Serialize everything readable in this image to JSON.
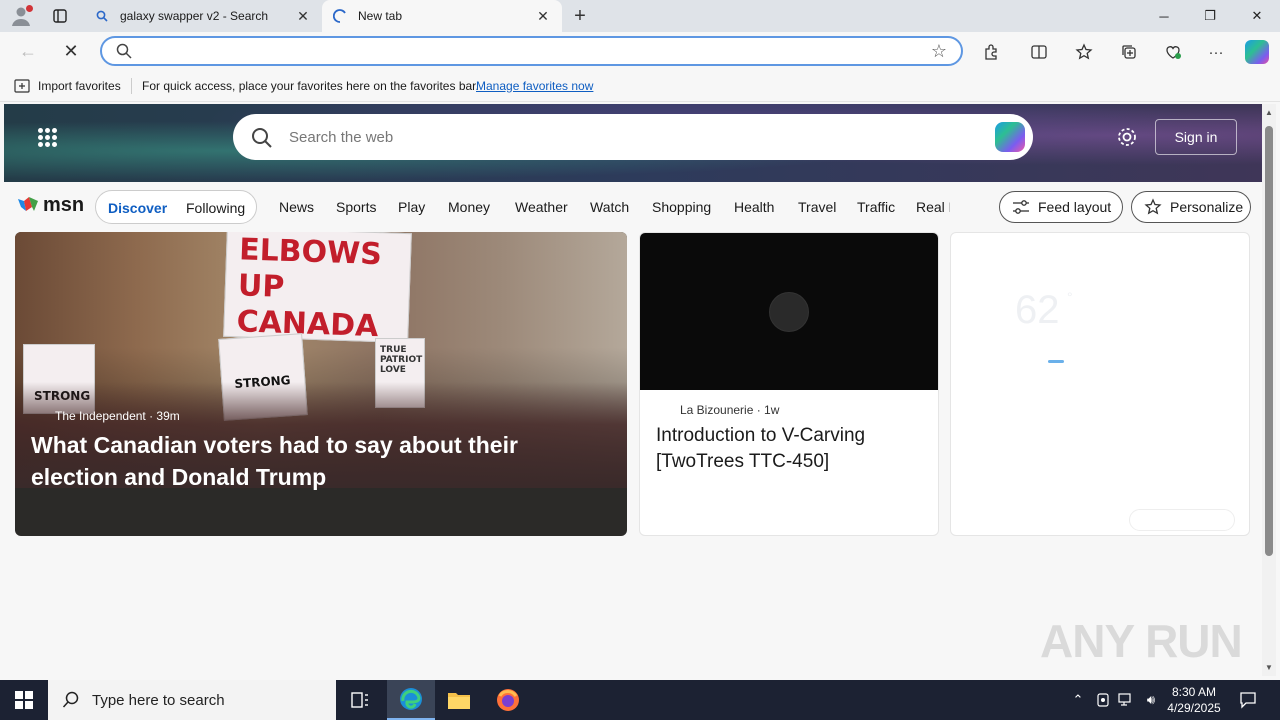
{
  "browser": {
    "tabs": [
      {
        "label": "galaxy swapper v2 - Search",
        "icon": "search-icon"
      },
      {
        "label": "New tab",
        "icon": "loading-icon"
      }
    ],
    "address": {
      "value": "",
      "placeholder": ""
    },
    "favorites_bar": {
      "import_label": "Import favorites",
      "message": "For quick access, place your favorites here on the favorites bar.",
      "link": "Manage favorites now"
    }
  },
  "msn": {
    "search_placeholder": "Search the web",
    "sign_in": "Sign in",
    "brand": "msn",
    "pivot": {
      "discover": "Discover",
      "following": "Following"
    },
    "categories": [
      "News",
      "Sports",
      "Play",
      "Money",
      "Weather",
      "Watch",
      "Shopping",
      "Health",
      "Travel",
      "Traffic",
      "Real E"
    ],
    "feed_layout": "Feed layout",
    "personalize": "Personalize",
    "cards": {
      "main": {
        "source": "The Independent · 39m",
        "headline": "What Canadian voters had to say about their election and Donald Trump",
        "sign_top": "ELBOWS UP CANADA",
        "sign_left": "STRONG",
        "sign_mid": "STRONG",
        "sign_right": "TRUE PATRIOT LOVE"
      },
      "video": {
        "source": "La Bizounerie · 1w",
        "title": "Introduction to V-Carving [TwoTrees TTC-450]"
      },
      "weather": {
        "temp": "62",
        "deg": "°"
      }
    },
    "watermark": "ANY RUN"
  },
  "taskbar": {
    "search_placeholder": "Type here to search",
    "time": "8:30 AM",
    "date": "4/29/2025"
  }
}
